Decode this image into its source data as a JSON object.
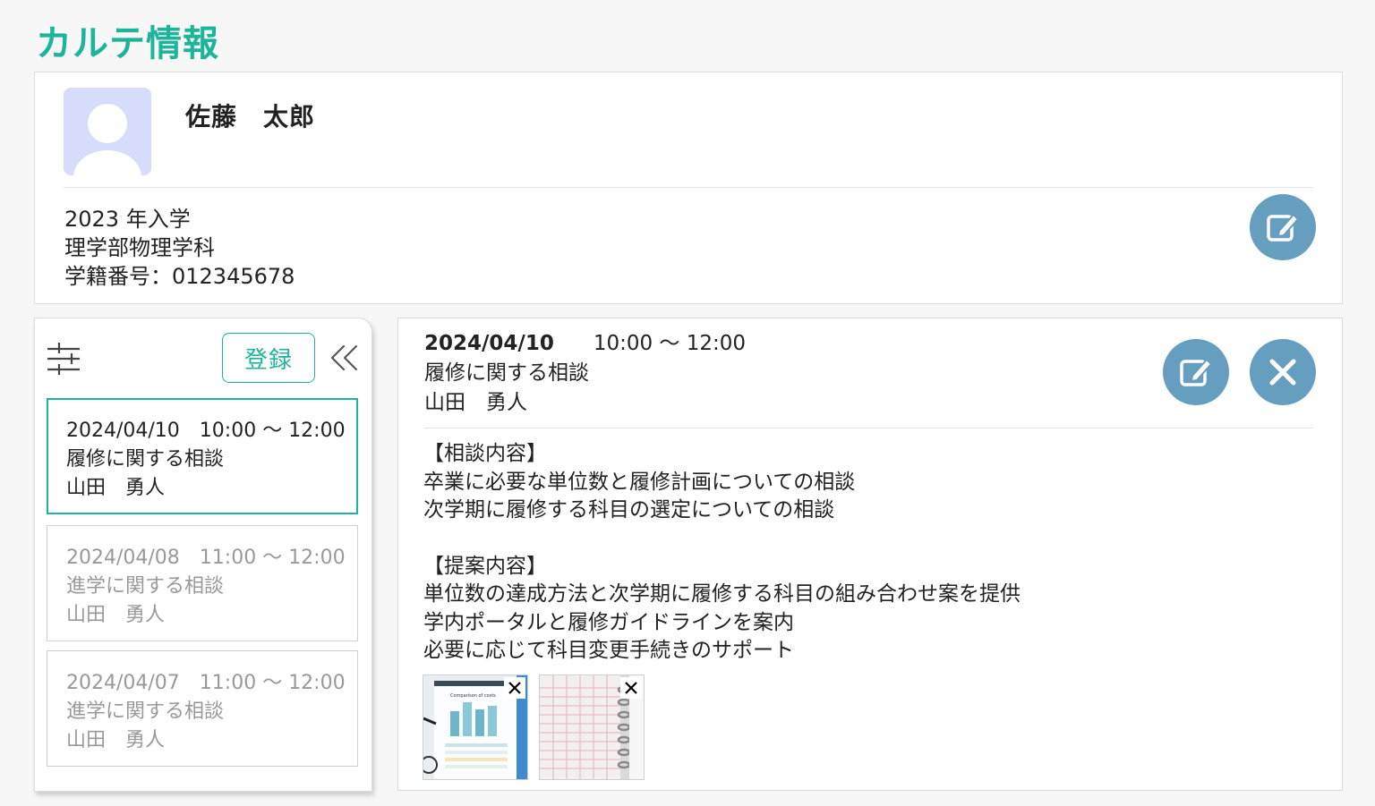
{
  "page": {
    "title": "カルテ情報"
  },
  "student": {
    "name": "佐藤　太郎",
    "enrollment": "2023 年入学",
    "department": "理学部物理学科",
    "student_id": "学籍番号：012345678"
  },
  "sidebar": {
    "register_label": "登録",
    "records": [
      {
        "datetime": "2024/04/10　10:00 〜 12:00",
        "topic": "履修に関する相談",
        "counselor": "山田　勇人",
        "active": true
      },
      {
        "datetime": "2024/04/08　11:00 〜 12:00",
        "topic": "進学に関する相談",
        "counselor": "山田　勇人",
        "active": false
      },
      {
        "datetime": "2024/04/07　11:00 〜 12:00",
        "topic": "進学に関する相談",
        "counselor": "山田　勇人",
        "active": false
      }
    ]
  },
  "detail": {
    "date": "2024/04/10",
    "time": "10:00 〜 12:00",
    "topic": "履修に関する相談",
    "counselor": "山田　勇人",
    "consultation_heading": "【相談内容】",
    "consultation_lines": [
      "卒業に必要な単位数と履修計画についての相談",
      "次学期に履修する科目の選定についての相談"
    ],
    "proposal_heading": "【提案内容】",
    "proposal_lines": [
      "単位数の達成方法と次学期に履修する科目の組み合わせ案を提供",
      "学内ポータルと履修ガイドラインを案内",
      "必要に応じて科目変更手続きのサポート"
    ],
    "attachments": [
      {
        "thumbnail_icon": "chart-document-photo-icon",
        "caption": "Comparison of costs"
      },
      {
        "thumbnail_icon": "calendar-notebook-photo-icon"
      }
    ]
  },
  "colors": {
    "accent": "#1db59a",
    "action_button": "#659ebf",
    "avatar_bg": "#d7dcfa",
    "inactive_text": "#999999"
  }
}
